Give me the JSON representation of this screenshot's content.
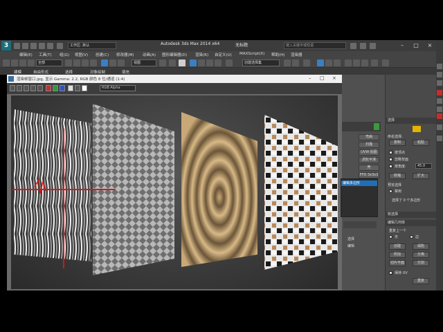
{
  "titlebar": {
    "workspace_label": "工作区: 默认",
    "app_title": "Autodesk 3ds Max  2014 x64",
    "doc_title": "无标题",
    "search_placeholder": "键入关键字或短语",
    "minimize": "–",
    "maximize": "□",
    "close": "×"
  },
  "menu": [
    "编辑(E)",
    "工具(T)",
    "组(G)",
    "视图(V)",
    "创建(C)",
    "修改器(M)",
    "动画(A)",
    "图形编辑器(D)",
    "渲染(R)",
    "自定义(U)",
    "MAXScript(X)",
    "帮助(H)",
    "渲染器"
  ],
  "toolbar": {
    "filter_value": "全部",
    "view_value": "视图",
    "selection_set": "创建选择集"
  },
  "ribbon": {
    "tabs": [
      "建模",
      "自由形式",
      "选择",
      "对象绘制",
      "填充"
    ]
  },
  "frame": {
    "title": "渲染帧窗口.jpg, 显示 Gamma: 2.2, RGB 颜色 8 位/通道 (1:4)",
    "channel": "RGB Alpha",
    "minimize": "–",
    "maximize": "□",
    "close": "×"
  },
  "rightpanel": {
    "buttons": [
      "弯曲",
      "扫描",
      "UVW 贴图",
      "涡轮平滑",
      "壳",
      "变化",
      "细化",
      "FFD 3x3x3"
    ],
    "list_selected": "编辑多边形",
    "bottom_labels": [
      "选择",
      "编辑"
    ]
  },
  "command_panel": {
    "sections": {
      "selection": "选择",
      "soft_selection": "软选择",
      "edit_geometry": "编辑几何体",
      "repeat": "重复上一个",
      "named_selection": "命名选择:"
    },
    "named_select_buttons": [
      "复制",
      "粘贴"
    ],
    "options": [
      "按顶点",
      "忽略背面",
      "按角度:",
      "收缩",
      "扩大",
      "环形",
      "循环"
    ],
    "angle_value": "45.0",
    "preview_label": "预览选择",
    "preview_options": [
      "禁用",
      "子对象",
      "多个"
    ],
    "status": "选择了 0 个多边形",
    "geom_buttons": [
      "创建",
      "塌陷",
      "附加",
      "分离",
      "切片平面",
      "分割"
    ],
    "constraint_label": "约束",
    "constraint_options": [
      "无",
      "边",
      "面",
      "法线"
    ],
    "bottom_buttons": [
      "保持 UV",
      "重复"
    ]
  },
  "colors": {
    "accent_blue": "#1f6fb8",
    "red_marker": "#d01a1a",
    "logo_teal": "#1a6f7a"
  }
}
